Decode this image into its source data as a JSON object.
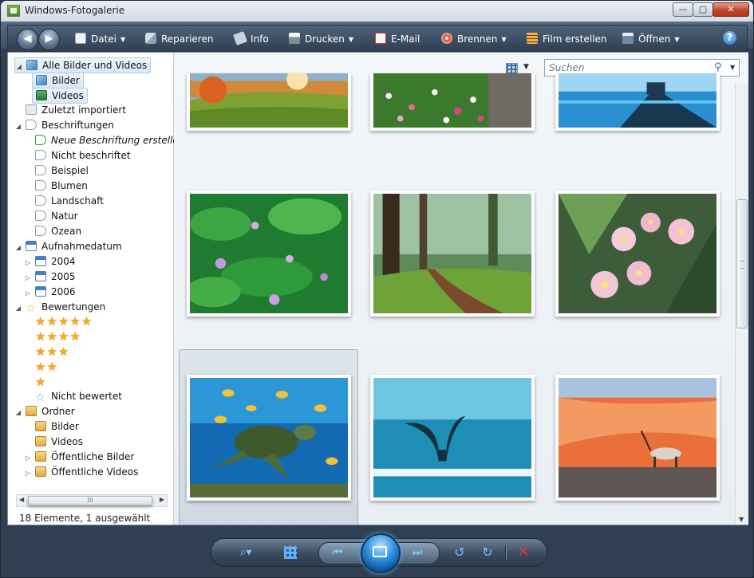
{
  "window": {
    "title": "Windows-Fotogalerie",
    "buttons": {
      "minimize": "—",
      "maximize": "▢",
      "close": "✕"
    }
  },
  "toolbar": {
    "back": "◀",
    "forward": "▶",
    "items": [
      {
        "label": "Datei",
        "icon": "file-icon",
        "dropdown": true
      },
      {
        "label": "Reparieren",
        "icon": "repair-icon",
        "dropdown": false
      },
      {
        "label": "Info",
        "icon": "info-tag-icon",
        "dropdown": false
      },
      {
        "label": "Drucken",
        "icon": "printer-icon",
        "dropdown": true
      },
      {
        "label": "E-Mail",
        "icon": "email-icon",
        "dropdown": false
      },
      {
        "label": "Brennen",
        "icon": "disc-icon",
        "dropdown": true
      },
      {
        "label": "Film erstellen",
        "icon": "film-icon",
        "dropdown": false
      },
      {
        "label": "Öffnen",
        "icon": "open-icon",
        "dropdown": true
      }
    ],
    "help": "?"
  },
  "navigation": {
    "all": "Alle Bilder und Videos",
    "pictures": "Bilder",
    "videos": "Videos",
    "recent": "Zuletzt importiert",
    "tags": "Beschriftungen",
    "new_tag": "Neue Beschriftung erstellen",
    "untagged": "Nicht beschriftet",
    "tag_items": [
      "Beispiel",
      "Blumen",
      "Landschaft",
      "Natur",
      "Ozean"
    ],
    "date_taken": "Aufnahmedatum",
    "years": [
      "2004",
      "2005",
      "2006"
    ],
    "ratings": "Bewertungen",
    "rating_rows": [
      "★★★★★",
      "★★★★",
      "★★★",
      "★★",
      "★"
    ],
    "not_rated": "Nicht bewertet",
    "folders": "Ordner",
    "folder_items": [
      "Bilder",
      "Videos",
      "Öffentliche Bilder",
      "Öffentliche Videos"
    ],
    "scroll_grip": "III"
  },
  "status": {
    "text": "18 Elemente, 1 ausgewählt"
  },
  "search": {
    "placeholder": "Suchen"
  },
  "controls": {
    "zoom": "⌕▾",
    "prev": "⏮",
    "next": "⏭",
    "rotate_left": "↺",
    "rotate_right": "↻",
    "delete": "✕"
  }
}
